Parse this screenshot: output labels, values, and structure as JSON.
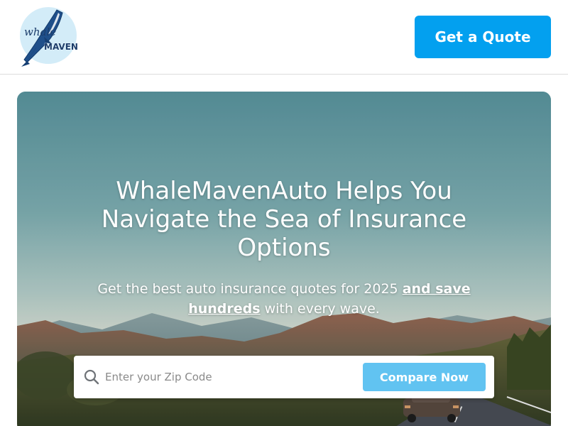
{
  "header": {
    "logo": {
      "text_top": "whale",
      "text_bottom": "MAVEN"
    },
    "cta_label": "Get a Quote"
  },
  "hero": {
    "title": "WhaleMavenAuto Helps You Navigate the Sea of Insurance Options",
    "subtitle_prefix": "Get the best auto insurance quotes for 2025 ",
    "subtitle_emphasis": "and save hundreds",
    "subtitle_suffix": " with every wave.",
    "search": {
      "icon": "search-icon",
      "placeholder": "Enter your Zip Code",
      "value": "",
      "button_label": "Compare Now"
    }
  },
  "colors": {
    "primary_button": "#03a0ef",
    "compare_button": "#61c3f1",
    "header_bg": "#ffffff"
  }
}
